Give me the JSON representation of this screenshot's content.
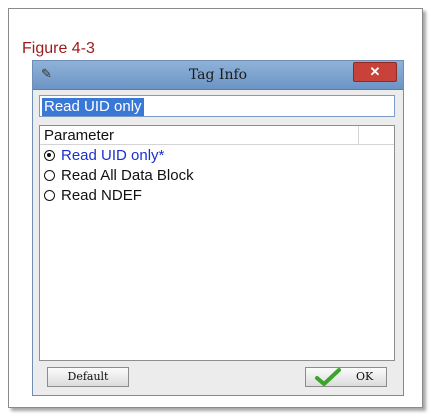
{
  "caption": "Figure 4-3",
  "window": {
    "title": "Tag Info",
    "title_icon": "pencil-icon",
    "close_icon": "close-icon",
    "close_label": "✕"
  },
  "name_field": {
    "value": "Read UID only"
  },
  "list": {
    "column_header": "Parameter",
    "options": [
      {
        "label": "Read UID only*",
        "selected": true
      },
      {
        "label": "Read All Data Block",
        "selected": false
      },
      {
        "label": "Read NDEF",
        "selected": false
      }
    ]
  },
  "buttons": {
    "default_label": "Default",
    "ok_label": "OK",
    "ok_icon": "checkmark-icon"
  },
  "colors": {
    "caption": "#9b1b1b",
    "selection_highlight": "#3a78d8",
    "selected_option_text": "#1a2fd0",
    "close_button": "#c9423a",
    "checkmark": "#3aa52b"
  }
}
